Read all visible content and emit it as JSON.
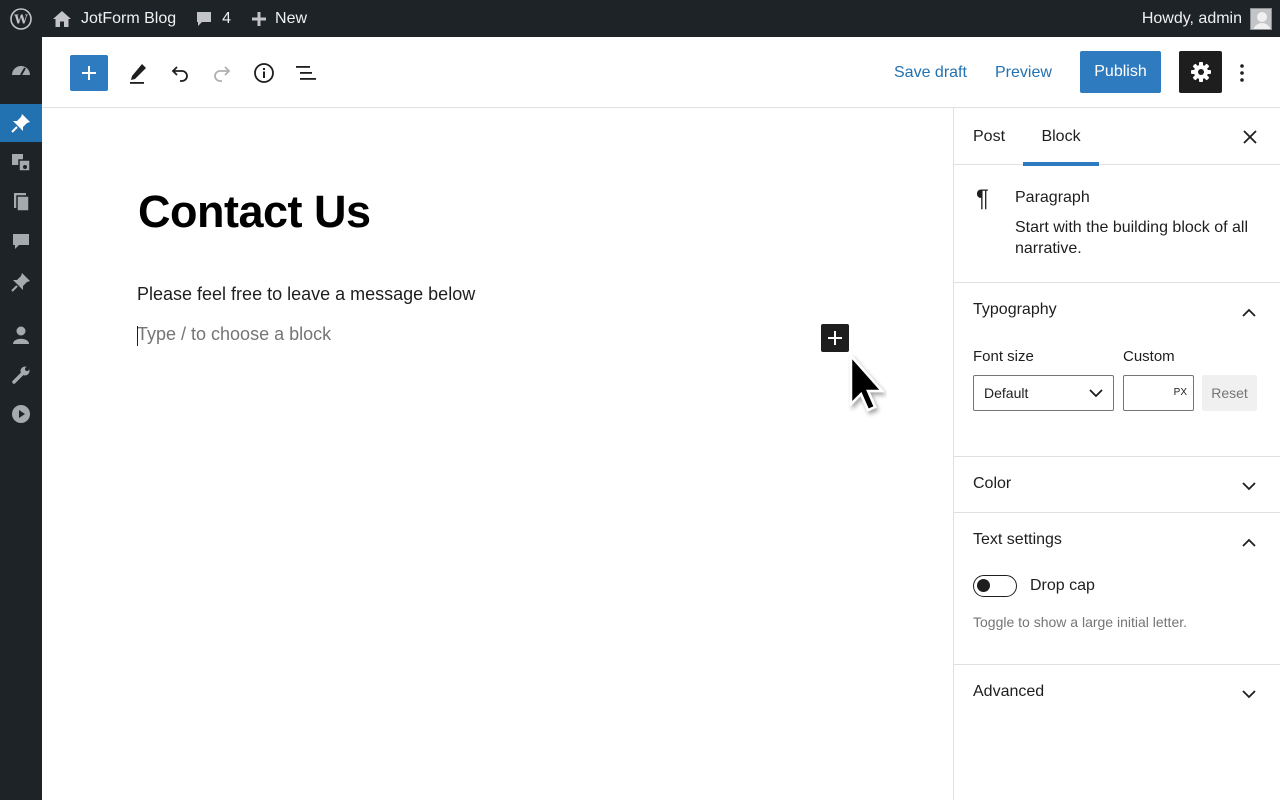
{
  "admin_bar": {
    "site_name": "JotForm Blog",
    "comments_count": "4",
    "new_label": "New",
    "greeting": "Howdy, admin"
  },
  "admin_menu": {
    "icons": [
      "dashboard-icon",
      "posts-icon",
      "media-icon",
      "pages-icon",
      "comments-icon",
      "pin-icon",
      "users-icon",
      "tools-icon",
      "play-icon"
    ],
    "active": "posts-icon"
  },
  "header": {
    "save_draft": "Save draft",
    "preview": "Preview",
    "publish": "Publish"
  },
  "editor": {
    "title": "Contact Us",
    "paragraph": "Please feel free to leave a message below",
    "placeholder": "Type / to choose a block"
  },
  "sidebar": {
    "tabs": [
      "Post",
      "Block"
    ],
    "active_tab": "Block",
    "block_card": {
      "title": "Paragraph",
      "description": "Start with the building block of all narrative."
    },
    "typography": {
      "title": "Typography",
      "font_size_label": "Font size",
      "custom_label": "Custom",
      "font_size_value": "Default",
      "unit": "PX",
      "reset": "Reset"
    },
    "color": {
      "title": "Color"
    },
    "text_settings": {
      "title": "Text settings",
      "drop_cap_label": "Drop cap",
      "drop_cap_help": "Toggle to show a large initial letter.",
      "drop_cap_on": false
    },
    "advanced": {
      "title": "Advanced"
    }
  },
  "colors": {
    "admin_dark": "#1d2327",
    "accent": "#2f7bbf",
    "link": "#2271b1"
  }
}
